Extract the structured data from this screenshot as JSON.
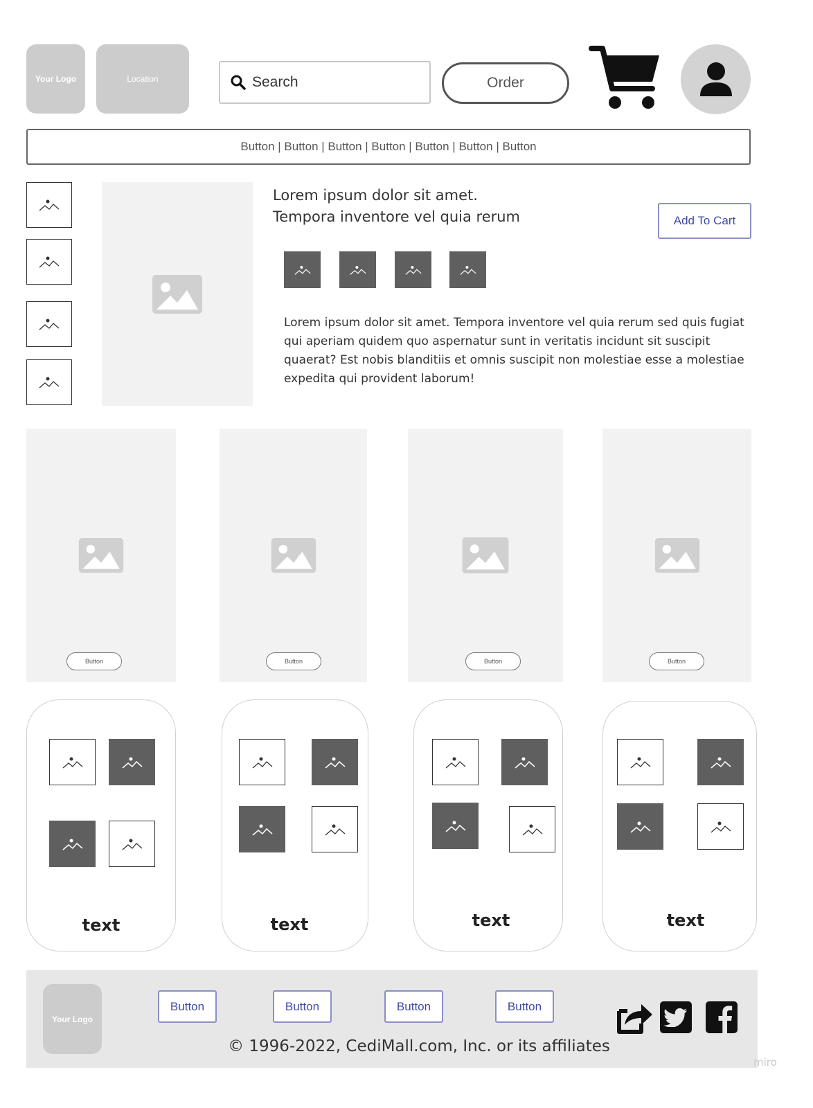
{
  "header": {
    "logo_label": "Your Logo",
    "location_label": "Location",
    "search_placeholder": "Search",
    "order_label": "Order",
    "icons": {
      "search": "search-icon",
      "cart": "cart-icon",
      "user": "user-icon"
    }
  },
  "nav": {
    "text": "Button | Button | Button | Button | Button | Button | Button"
  },
  "product": {
    "title_line1": "Lorem ipsum dolor sit amet.",
    "title_line2": "Tempora inventore vel quia rerum",
    "add_to_cart_label": "Add To Cart",
    "description": "Lorem ipsum dolor sit amet. Tempora inventore vel quia rerum sed quis fugiat qui aperiam quidem quo aspernatur sunt in veritatis incidunt sit suscipit quaerat? Est nobis blanditiis et omnis suscipit non molestiae esse a molestiae expedita qui provident laborum!"
  },
  "tiles": [
    {
      "button_label": "Button"
    },
    {
      "button_label": "Button"
    },
    {
      "button_label": "Button"
    },
    {
      "button_label": "Button"
    }
  ],
  "cards": [
    {
      "label": "text"
    },
    {
      "label": "text"
    },
    {
      "label": "text"
    },
    {
      "label": "text"
    }
  ],
  "footer": {
    "logo_label": "Your Logo",
    "buttons": [
      "Button",
      "Button",
      "Button",
      "Button"
    ],
    "copyright": "© 1996-2022, CediMall.com, Inc. or its affiliates",
    "icons": {
      "share": "share-icon",
      "twitter": "twitter-icon",
      "facebook": "facebook-icon"
    }
  },
  "watermark": "miro",
  "colors": {
    "placeholder": "#f2f2f2",
    "dark_thumb": "#5f5f5f",
    "link_blue": "#3f4aa3",
    "footer_bg": "#e7e7e7"
  }
}
